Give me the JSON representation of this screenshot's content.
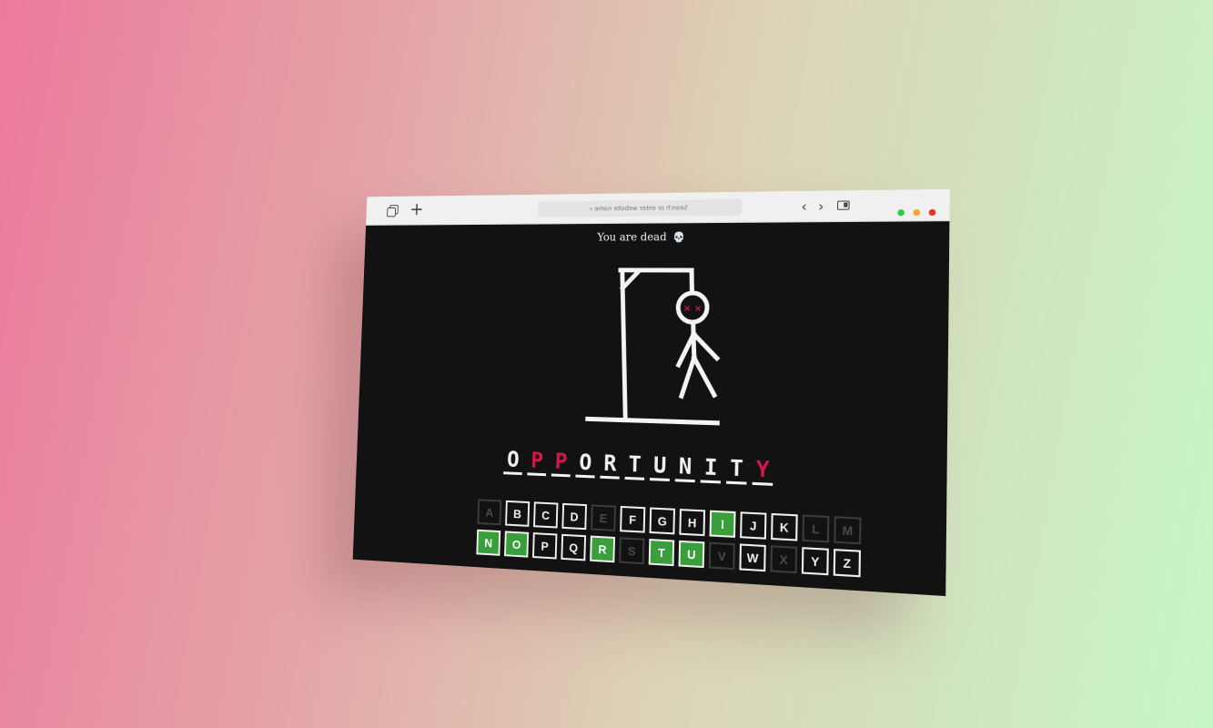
{
  "browser": {
    "address_placeholder": "Search or enter website name",
    "search_glyph": "⌕",
    "plus_glyph": "+",
    "back_glyph": "‹",
    "forward_glyph": "›",
    "traffic_lights": [
      "#2ecb41",
      "#f7a524",
      "#e8302a"
    ]
  },
  "game": {
    "status_text": "You are dead",
    "status_icon": "skull-icon",
    "status_glyph": "💀",
    "word": [
      "O",
      "P",
      "P",
      "O",
      "R",
      "T",
      "U",
      "N",
      "I",
      "T",
      "Y"
    ],
    "missed_indices": [
      1,
      2,
      10
    ],
    "eyes": "× ×",
    "colors": {
      "correct": "#3a9e3a",
      "missed": "#d4174b",
      "background": "#121212"
    },
    "keyboard": [
      [
        {
          "letter": "A",
          "state": "wrong"
        },
        {
          "letter": "B",
          "state": "unused"
        },
        {
          "letter": "C",
          "state": "unused"
        },
        {
          "letter": "D",
          "state": "unused"
        },
        {
          "letter": "E",
          "state": "wrong"
        },
        {
          "letter": "F",
          "state": "unused"
        },
        {
          "letter": "G",
          "state": "unused"
        },
        {
          "letter": "H",
          "state": "unused"
        },
        {
          "letter": "I",
          "state": "correct"
        },
        {
          "letter": "J",
          "state": "unused"
        },
        {
          "letter": "K",
          "state": "unused"
        },
        {
          "letter": "L",
          "state": "wrong"
        },
        {
          "letter": "M",
          "state": "wrong"
        }
      ],
      [
        {
          "letter": "N",
          "state": "correct"
        },
        {
          "letter": "O",
          "state": "correct"
        },
        {
          "letter": "P",
          "state": "unused"
        },
        {
          "letter": "Q",
          "state": "unused"
        },
        {
          "letter": "R",
          "state": "correct"
        },
        {
          "letter": "S",
          "state": "wrong"
        },
        {
          "letter": "T",
          "state": "correct"
        },
        {
          "letter": "U",
          "state": "correct"
        },
        {
          "letter": "V",
          "state": "wrong"
        },
        {
          "letter": "W",
          "state": "unused"
        },
        {
          "letter": "X",
          "state": "wrong"
        },
        {
          "letter": "Y",
          "state": "unused"
        },
        {
          "letter": "Z",
          "state": "unused"
        }
      ]
    ]
  }
}
